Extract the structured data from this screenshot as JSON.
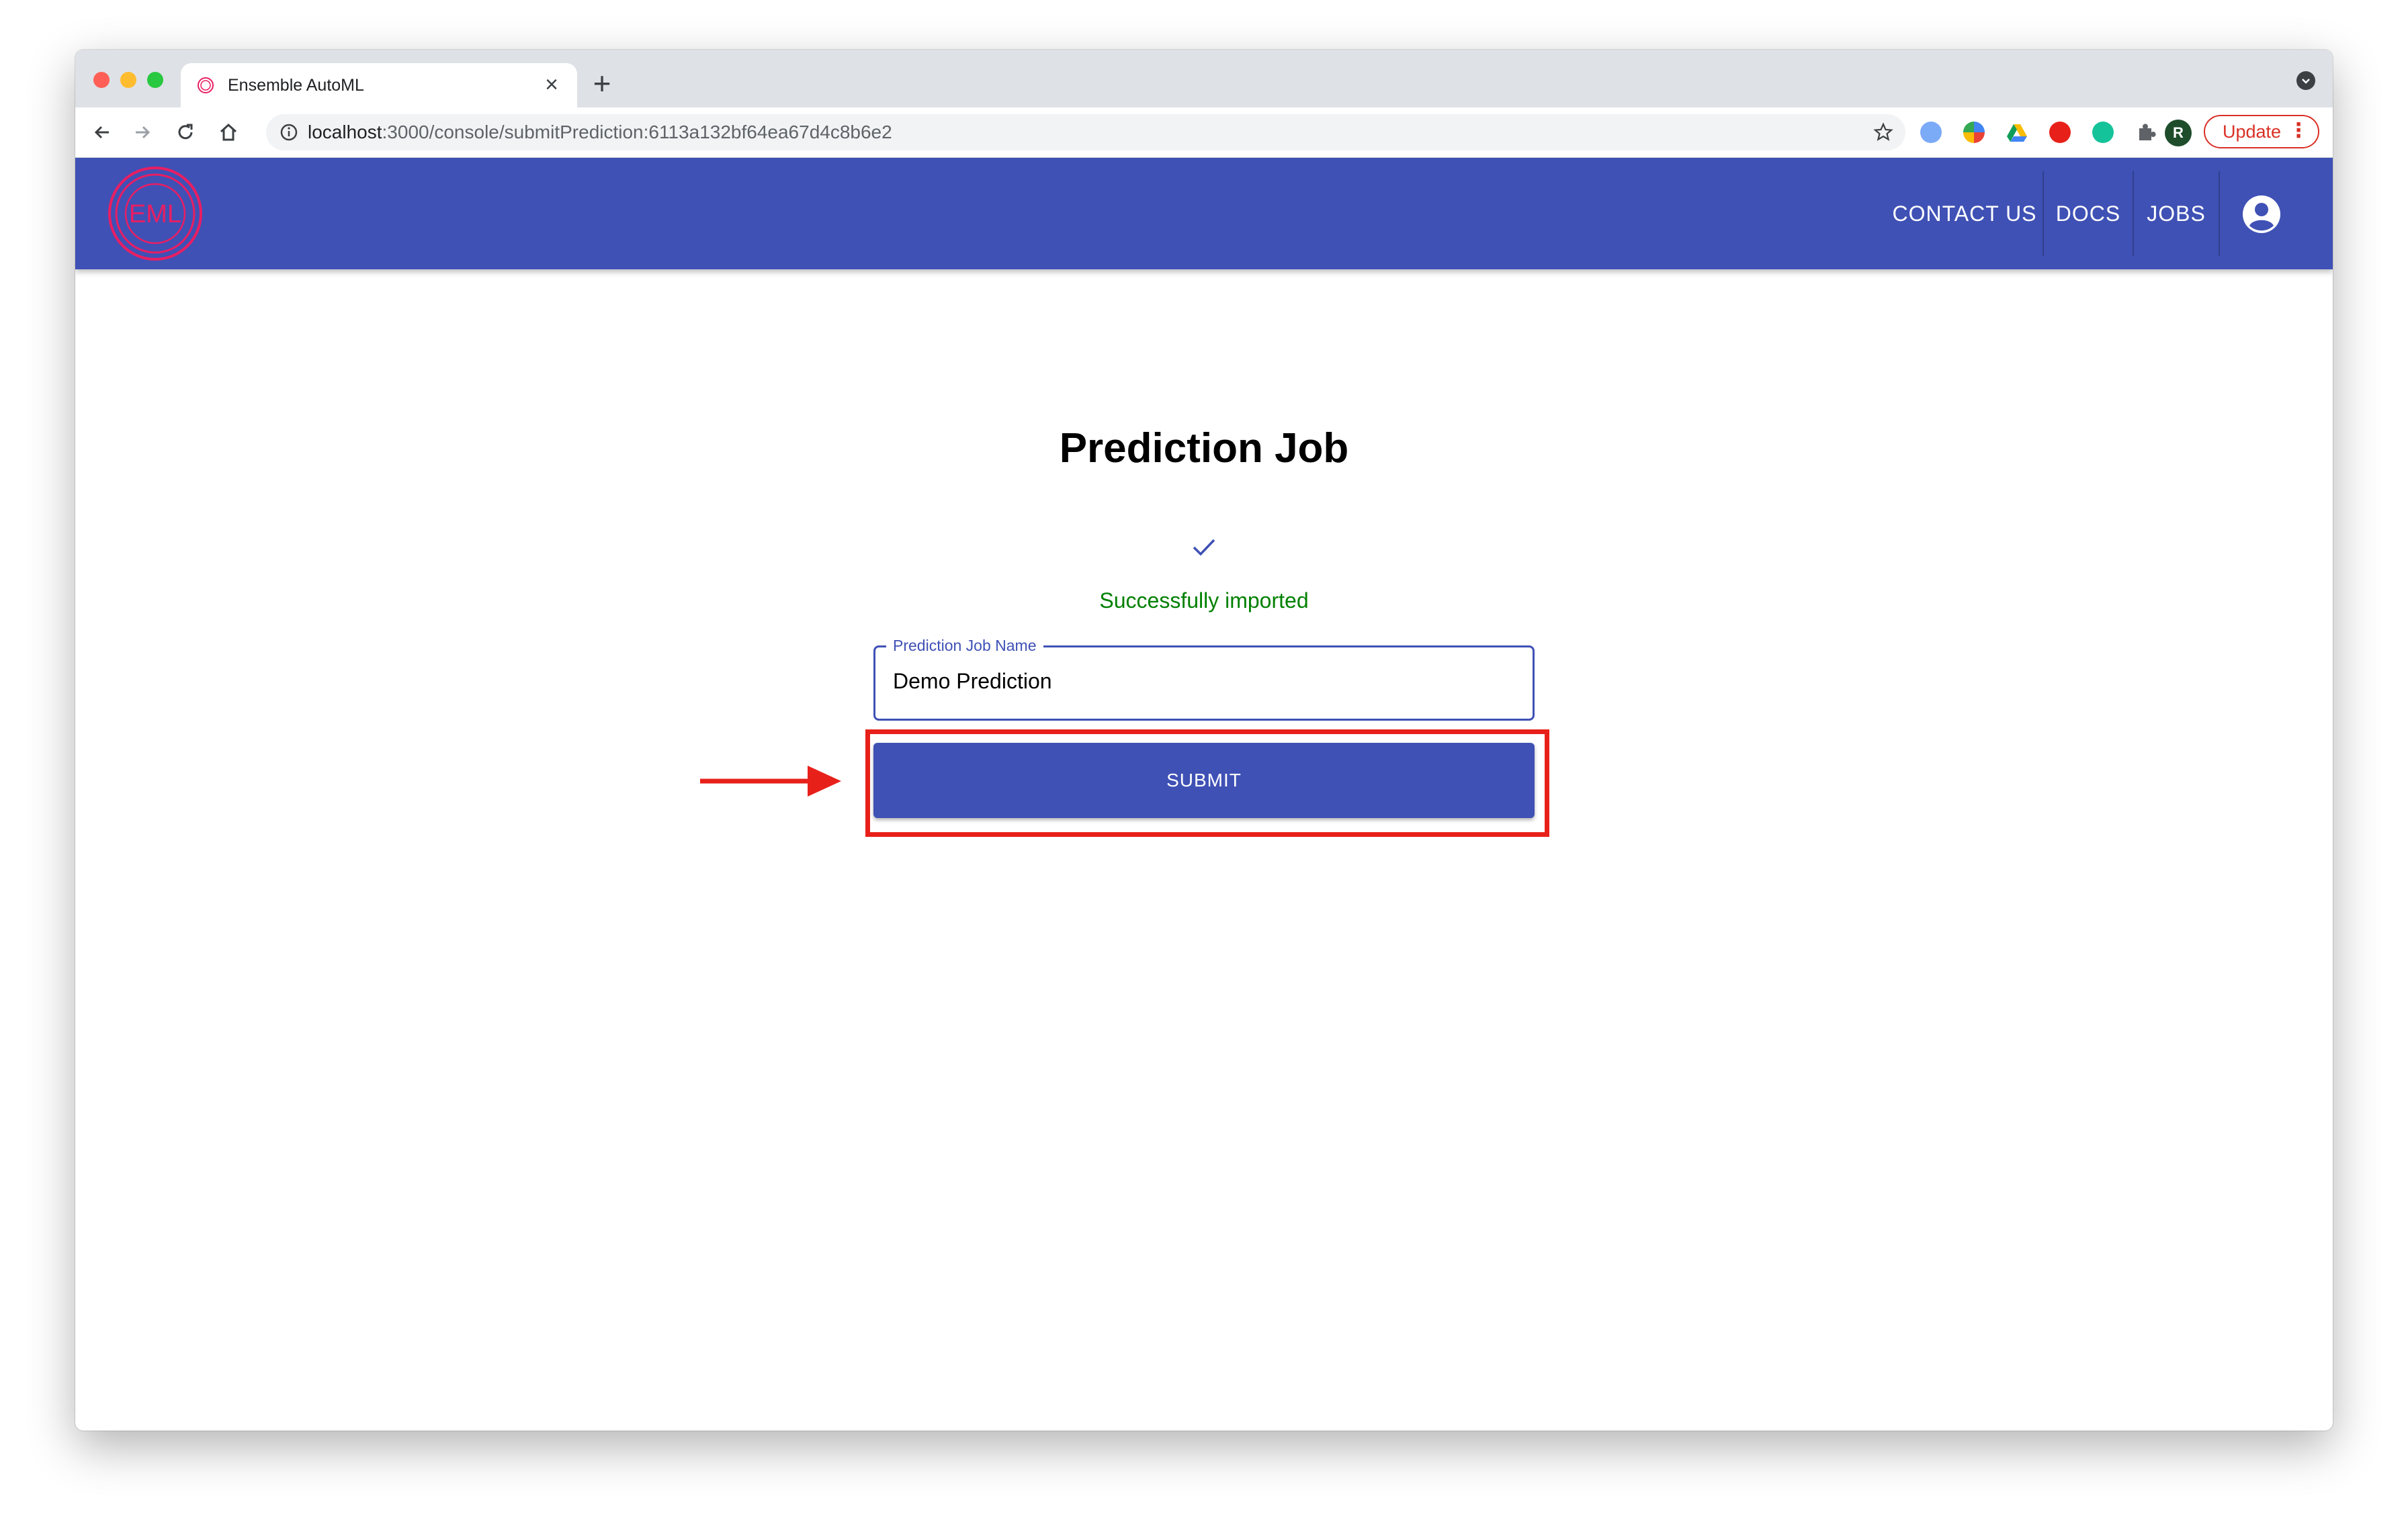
{
  "browser": {
    "tab_title": "Ensemble AutoML",
    "tab_close": "×",
    "new_tab": "+",
    "url_host": "localhost",
    "url_path": ":3000/console/submitPrediction:6113a132bf64ea67d4c8b6e2",
    "profile_initial": "R",
    "update_label": "Update",
    "update_menu": "⋮"
  },
  "appbar": {
    "logo_text": "EML",
    "nav": [
      "CONTACT US",
      "DOCS",
      "JOBS"
    ]
  },
  "main": {
    "title": "Prediction Job",
    "success_message": "Successfully imported",
    "field_label": "Prediction Job Name",
    "field_value": "Demo Prediction",
    "submit_label": "SUBMIT"
  },
  "colors": {
    "primary": "#3f51b5",
    "success": "#008000",
    "annotation": "#e8201a",
    "logo": "#e91e63"
  },
  "icons": [
    "back-arrow-icon",
    "forward-arrow-icon",
    "reload-icon",
    "home-icon",
    "info-icon",
    "star-icon",
    "puzzle-icon",
    "account-circle-icon",
    "check-icon",
    "annotation-arrow-icon"
  ]
}
